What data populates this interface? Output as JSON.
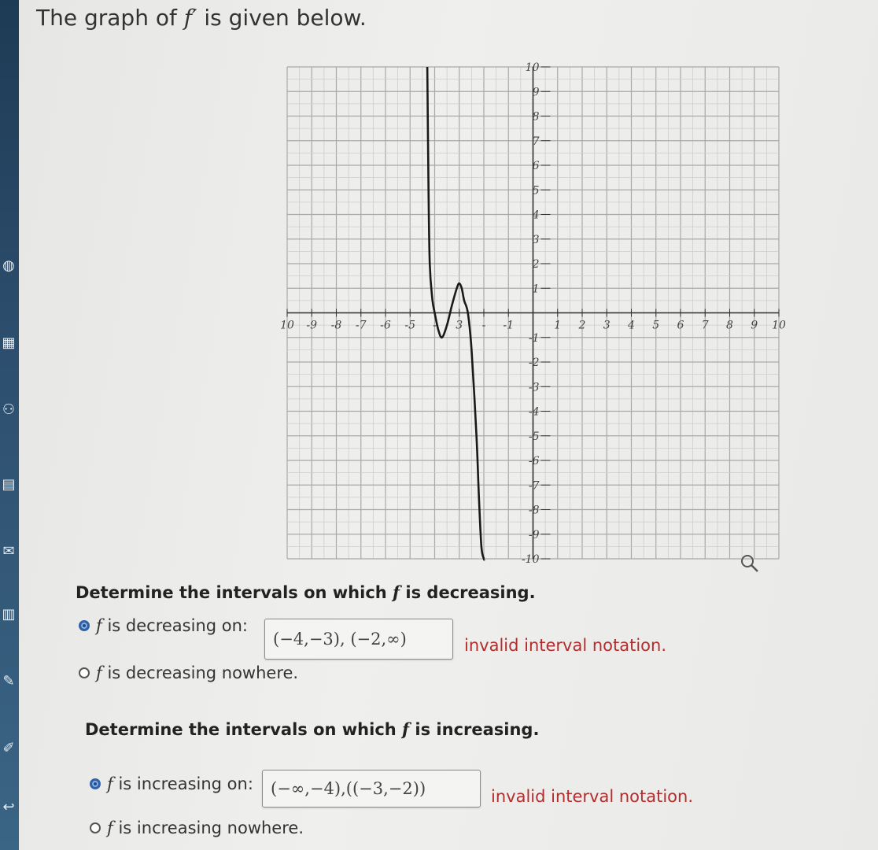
{
  "header": {
    "prefix": "The graph of",
    "func": "f′",
    "suffix": "is given below."
  },
  "colors": {
    "error": "#b22d2d",
    "radio_selected": "#1a4a8f",
    "sidebar": "#2e5070",
    "curve": "#1a1a1a"
  },
  "sidebar_icons": [
    "globe-icon",
    "calculator-icon",
    "people-icon",
    "grid-icon",
    "mail-icon",
    "document-icon",
    "pencil-icon",
    "edit-icon",
    "exit-icon"
  ],
  "sidebar_glyphs": [
    "◍",
    "▦",
    "⚇",
    "▤",
    "✉",
    "▥",
    "✎",
    "✐",
    "↩"
  ],
  "chart_data": {
    "type": "line",
    "xlim": [
      -10,
      10
    ],
    "ylim": [
      -10,
      10
    ],
    "grid": true,
    "x_ticks": [
      -10,
      -9,
      -8,
      -7,
      -6,
      -5,
      -4,
      -3,
      -2,
      -1,
      1,
      2,
      3,
      4,
      5,
      6,
      7,
      8,
      9,
      10
    ],
    "y_ticks": [
      -10,
      -9,
      -8,
      -7,
      -6,
      -5,
      -4,
      -3,
      -2,
      -1,
      1,
      2,
      3,
      4,
      5,
      6,
      7,
      8,
      9,
      10
    ],
    "x_tick_labels": [
      "10",
      "-9",
      "-8",
      "-7",
      "-6",
      "-5",
      "-",
      "3",
      "-",
      "-1",
      "1",
      "2",
      "3",
      "4",
      "5",
      "6",
      "7",
      "8",
      "9",
      "10"
    ],
    "y_tick_labels": [
      "-10",
      "-9",
      "-8",
      "-7",
      "-6",
      "-5",
      "-4",
      "-3",
      "-2",
      "-1",
      "1",
      "2",
      "3",
      "4",
      "5",
      "6",
      "7",
      "8",
      "9",
      "10"
    ],
    "series": [
      {
        "x": [
          -4.3,
          -4.25,
          -4.2,
          -4.1,
          -4.0,
          -3.85,
          -3.7,
          -3.5,
          -3.3,
          -3.1,
          -3.0,
          -2.9,
          -2.8,
          -2.65,
          -2.5,
          -2.3,
          -2.2,
          -2.1,
          -2.0,
          -1.98
        ],
        "y": [
          10.5,
          5.0,
          2.0,
          0.6,
          0.0,
          -0.7,
          -1.0,
          -0.5,
          0.3,
          1.0,
          1.2,
          1.0,
          0.5,
          0.0,
          -1.5,
          -5.0,
          -7.5,
          -9.5,
          -10.0,
          -10.5
        ]
      }
    ],
    "corner_icon": "zoom-icon"
  },
  "q1": {
    "prompt": "Determine the intervals on which",
    "func": "f",
    "tail": "is decreasing.",
    "opt1_func": "f",
    "opt1_text": "is decreasing on:",
    "opt1_value": "(−4,−3), (−2,∞)",
    "opt1_error": "invalid interval notation.",
    "opt2_func": "f",
    "opt2_text": "is decreasing nowhere."
  },
  "q2": {
    "prompt": "Determine the intervals on which",
    "func": "f",
    "tail": "is increasing.",
    "opt1_func": "f",
    "opt1_text": "is increasing on:",
    "opt1_value": "(−∞,−4),((−3,−2))",
    "opt1_error": "invalid interval notation.",
    "opt2_func": "f",
    "opt2_text": "is increasing nowhere."
  }
}
